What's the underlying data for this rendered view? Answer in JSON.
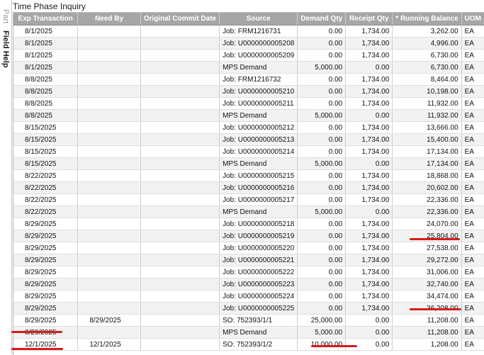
{
  "side_tabs": {
    "part": "Part",
    "field_help": "Field Help"
  },
  "title": "Time Phase Inquiry",
  "columns": [
    "Exp Transaction",
    "Need By",
    "Original Commit Date",
    "Source",
    "Demand Qty",
    "Receipt Qty",
    "* Running Balance",
    "UOM"
  ],
  "rows": [
    [
      "8/1/2025",
      "",
      "",
      "Job: FRM1216731",
      "0.00",
      "1,734.00",
      "3,262.00",
      "EA"
    ],
    [
      "8/1/2025",
      "",
      "",
      "Job: U0000000005208",
      "0.00",
      "1,734.00",
      "4,996.00",
      "EA"
    ],
    [
      "8/1/2025",
      "",
      "",
      "Job: U0000000005209",
      "0.00",
      "1,734.00",
      "6,730.00",
      "EA"
    ],
    [
      "8/1/2025",
      "",
      "",
      "MPS Demand",
      "5,000.00",
      "0.00",
      "6,730.00",
      "EA"
    ],
    [
      "8/8/2025",
      "",
      "",
      "Job: FRM1216732",
      "0.00",
      "1,734.00",
      "8,464.00",
      "EA"
    ],
    [
      "8/8/2025",
      "",
      "",
      "Job: U0000000005210",
      "0.00",
      "1,734.00",
      "10,198.00",
      "EA"
    ],
    [
      "8/8/2025",
      "",
      "",
      "Job: U0000000005211",
      "0.00",
      "1,734.00",
      "11,932.00",
      "EA"
    ],
    [
      "8/8/2025",
      "",
      "",
      "MPS Demand",
      "5,000.00",
      "0.00",
      "11,932.00",
      "EA"
    ],
    [
      "8/15/2025",
      "",
      "",
      "Job: U0000000005212",
      "0.00",
      "1,734.00",
      "13,666.00",
      "EA"
    ],
    [
      "8/15/2025",
      "",
      "",
      "Job: U0000000005213",
      "0.00",
      "1,734.00",
      "15,400.00",
      "EA"
    ],
    [
      "8/15/2025",
      "",
      "",
      "Job: U0000000005214",
      "0.00",
      "1,734.00",
      "17,134.00",
      "EA"
    ],
    [
      "8/15/2025",
      "",
      "",
      "MPS Demand",
      "5,000.00",
      "0.00",
      "17,134.00",
      "EA"
    ],
    [
      "8/22/2025",
      "",
      "",
      "Job: U0000000005215",
      "0.00",
      "1,734.00",
      "18,868.00",
      "EA"
    ],
    [
      "8/22/2025",
      "",
      "",
      "Job: U0000000005216",
      "0.00",
      "1,734.00",
      "20,602.00",
      "EA"
    ],
    [
      "8/22/2025",
      "",
      "",
      "Job: U0000000005217",
      "0.00",
      "1,734.00",
      "22,336.00",
      "EA"
    ],
    [
      "8/22/2025",
      "",
      "",
      "MPS Demand",
      "5,000.00",
      "0.00",
      "22,336.00",
      "EA"
    ],
    [
      "8/29/2025",
      "",
      "",
      "Job: U0000000005218",
      "0.00",
      "1,734.00",
      "24,070.00",
      "EA"
    ],
    [
      "8/29/2025",
      "",
      "",
      "Job: U0000000005219",
      "0.00",
      "1,734.00",
      "25,804.00",
      "EA"
    ],
    [
      "8/29/2025",
      "",
      "",
      "Job: U0000000005220",
      "0.00",
      "1,734.00",
      "27,538.00",
      "EA"
    ],
    [
      "8/29/2025",
      "",
      "",
      "Job: U0000000005221",
      "0.00",
      "1,734.00",
      "29,272.00",
      "EA"
    ],
    [
      "8/29/2025",
      "",
      "",
      "Job: U0000000005222",
      "0.00",
      "1,734.00",
      "31,006.00",
      "EA"
    ],
    [
      "8/29/2025",
      "",
      "",
      "Job: U0000000005223",
      "0.00",
      "1,734.00",
      "32,740.00",
      "EA"
    ],
    [
      "8/29/2025",
      "",
      "",
      "Job: U0000000005224",
      "0.00",
      "1,734.00",
      "34,474.00",
      "EA"
    ],
    [
      "8/29/2025",
      "",
      "",
      "Job: U0000000005225",
      "0.00",
      "1,734.00",
      "36,208.00",
      "EA"
    ],
    [
      "8/29/2025",
      "8/29/2025",
      "",
      "SO: 752393/1/1",
      "25,000.00",
      "0.00",
      "11,208.00",
      "EA"
    ],
    [
      "8/29/2025",
      "",
      "",
      "MPS Demand",
      "5,000.00",
      "0.00",
      "11,208.00",
      "EA"
    ],
    [
      "12/1/2025",
      "12/1/2025",
      "",
      "SO: 752393/1/2",
      "10,000.00",
      "0.00",
      "1,208.00",
      "EA"
    ]
  ],
  "annotation_color": "#d81b1b"
}
